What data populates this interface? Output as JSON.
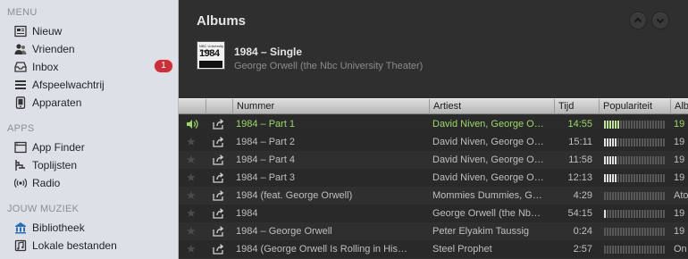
{
  "sidebar": {
    "menu_title": "MENU",
    "menu_items": [
      {
        "label": "Nieuw",
        "icon": "news-icon"
      },
      {
        "label": "Vrienden",
        "icon": "people-icon"
      },
      {
        "label": "Inbox",
        "icon": "inbox-icon",
        "badge": "1"
      },
      {
        "label": "Afspeelwachtrij",
        "icon": "queue-icon"
      },
      {
        "label": "Apparaten",
        "icon": "device-icon"
      }
    ],
    "apps_title": "APPS",
    "app_items": [
      {
        "label": "App Finder",
        "icon": "app-finder-icon"
      },
      {
        "label": "Toplijsten",
        "icon": "toplist-icon"
      },
      {
        "label": "Radio",
        "icon": "radio-icon"
      }
    ],
    "music_title": "JOUW MUZIEK",
    "music_items": [
      {
        "label": "Bibliotheek",
        "icon": "library-icon"
      },
      {
        "label": "Lokale bestanden",
        "icon": "local-files-icon"
      }
    ]
  },
  "main": {
    "title": "Albums",
    "album": {
      "name": "1984 – Single",
      "artist": "George Orwell (the Nbc University Theater)",
      "cover_text": "1984",
      "cover_top": "NBC University Theater"
    }
  },
  "table": {
    "columns": [
      "Nummer",
      "Artiest",
      "Tijd",
      "Populariteit",
      "Alb"
    ],
    "rows": [
      {
        "title": "1984 – Part 1",
        "artist": "David Niven, George O…",
        "time": "14:55",
        "popularity": 0.28,
        "album": "19",
        "playing": true
      },
      {
        "title": "1984 – Part 2",
        "artist": "David Niven, George O…",
        "time": "15:11",
        "popularity": 0.22,
        "album": "19",
        "playing": false
      },
      {
        "title": "1984 – Part 4",
        "artist": "David Niven, George O…",
        "time": "11:58",
        "popularity": 0.2,
        "album": "19",
        "playing": false
      },
      {
        "title": "1984 – Part 3",
        "artist": "David Niven, George O…",
        "time": "12:13",
        "popularity": 0.2,
        "album": "19",
        "playing": false
      },
      {
        "title": "1984 (feat. George Orwell)",
        "artist": "Mommies Dummies, G…",
        "time": "4:29",
        "popularity": 0.0,
        "album": "Ato",
        "playing": false
      },
      {
        "title": "1984",
        "artist": "George Orwell (the Nb…",
        "time": "54:15",
        "popularity": 0.05,
        "album": "19",
        "playing": false
      },
      {
        "title": "1984 – George Orwell",
        "artist": "Peter Elyakim Taussig",
        "time": "0:24",
        "popularity": 0.0,
        "album": "19",
        "playing": false
      },
      {
        "title": "1984 (George Orwell Is Rolling in His…",
        "artist": "Steel Prophet",
        "time": "2:57",
        "popularity": 0.0,
        "album": "On",
        "playing": false
      }
    ]
  },
  "colors": {
    "accent_green": "#9cd76a",
    "badge_red": "#c8303a",
    "sidebar_bg": "#dde1e7"
  }
}
